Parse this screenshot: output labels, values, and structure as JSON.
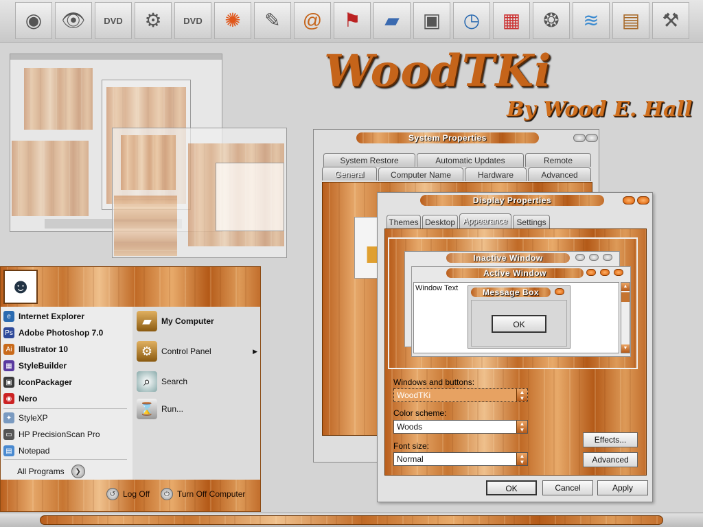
{
  "theme": {
    "accent": "#c5641a",
    "wood_dark": "#b45a18",
    "wood_light": "#efc08c",
    "desktop": "#d4d4d4"
  },
  "iconbar": {
    "icons": [
      "browser-icon",
      "eye-icon",
      "dvd-icon",
      "control-panel-icon",
      "dvd-video-icon",
      "swirl-icon",
      "tools-icon",
      "window-icon",
      "email-icon",
      "flag-icon",
      "folder-icon",
      "monitor-icon",
      "clock-icon",
      "paint-icon",
      "bubbles-icon",
      "wave-icon",
      "cabinet-icon",
      "hammer-icon"
    ]
  },
  "logo": {
    "title": "WoodTKi",
    "byline": "By Wood E. Hall"
  },
  "start_menu": {
    "pinned": [
      {
        "label": "Internet Explorer",
        "icon": "internet-explorer-icon"
      },
      {
        "label": "Adobe Photoshop 7.0",
        "icon": "photoshop-icon"
      },
      {
        "label": "Illustrator 10",
        "icon": "illustrator-icon"
      },
      {
        "label": "StyleBuilder",
        "icon": "stylebuilder-icon"
      },
      {
        "label": "IconPackager",
        "icon": "iconpackager-icon"
      },
      {
        "label": "Nero",
        "icon": "nero-icon"
      }
    ],
    "recent": [
      {
        "label": "StyleXP",
        "icon": "stylexp-icon"
      },
      {
        "label": "HP PrecisionScan Pro",
        "icon": "scanner-icon"
      },
      {
        "label": "Notepad",
        "icon": "notepad-icon"
      }
    ],
    "all_programs": "All Programs",
    "right": [
      {
        "label": "My Computer",
        "icon": "my-computer-icon"
      },
      {
        "label": "Control Panel",
        "icon": "control-panel-icon"
      },
      {
        "label": "Search",
        "icon": "search-icon"
      },
      {
        "label": "Run...",
        "icon": "run-icon"
      }
    ],
    "log_off": "Log Off",
    "turn_off": "Turn Off Computer"
  },
  "system_properties": {
    "title": "System Properties",
    "tabs_back": [
      "System Restore",
      "Automatic Updates",
      "Remote"
    ],
    "tabs_front": [
      "General",
      "Computer Name",
      "Hardware",
      "Advanced"
    ]
  },
  "display_properties": {
    "title": "Display Properties",
    "tabs": [
      "Themes",
      "Desktop",
      "Appearance",
      "Settings"
    ],
    "preview": {
      "inactive_title": "Inactive Window",
      "active_title": "Active Window",
      "window_text": "Window Text",
      "message_title": "Message Box",
      "ok": "OK"
    },
    "windows_buttons_label": "Windows and buttons:",
    "windows_buttons_value": "WoodTKi",
    "color_scheme_label": "Color scheme:",
    "color_scheme_value": "Woods",
    "font_size_label": "Font size:",
    "font_size_value": "Normal",
    "effects": "Effects...",
    "advanced": "Advanced",
    "ok": "OK",
    "cancel": "Cancel",
    "apply": "Apply"
  }
}
